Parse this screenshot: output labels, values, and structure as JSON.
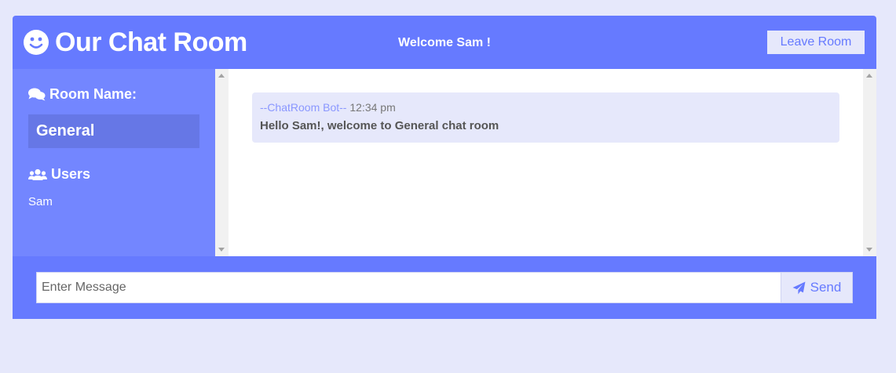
{
  "header": {
    "title": "Our Chat Room",
    "welcome": "Welcome Sam !",
    "leave_label": "Leave Room",
    "logo_icon": "smile-icon"
  },
  "sidebar": {
    "room_heading": "Room Name:",
    "room_icon": "comments-icon",
    "room_name": "General",
    "users_heading": "Users",
    "users_icon": "users-icon",
    "users": [
      "Sam"
    ]
  },
  "messages": [
    {
      "author": "--ChatRoom Bot--",
      "time": "12:34 pm",
      "text": "Hello Sam!, welcome to General chat room"
    }
  ],
  "composer": {
    "placeholder": "Enter Message",
    "value": "",
    "send_label": "Send",
    "send_icon": "paper-plane-icon"
  },
  "colors": {
    "background": "#e6e8fb",
    "primary": "#667aff",
    "sidebar": "#7386ff",
    "room_highlight": "#6677e6",
    "message_bg": "#e6e8fb",
    "author": "#8a97ff"
  }
}
